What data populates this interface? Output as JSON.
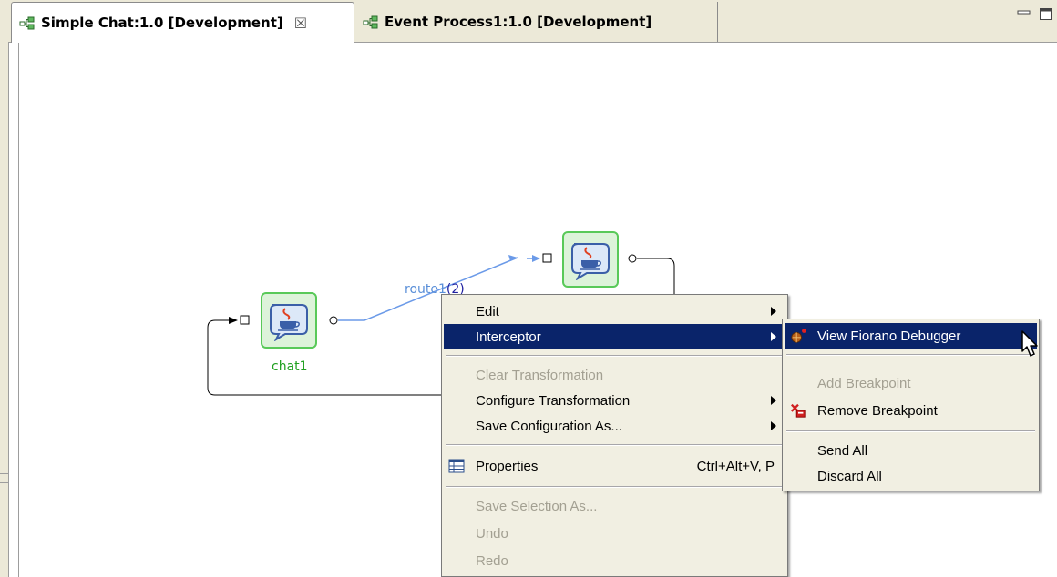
{
  "tabs": [
    {
      "label": "Simple Chat:1.0 [Development]",
      "icon": "flow-diagram-icon",
      "active": true,
      "closable": true
    },
    {
      "label": "Event Process1:1.0 [Development]",
      "icon": "flow-diagram-icon",
      "active": false
    }
  ],
  "window_controls": {
    "minimize": "minimize-icon",
    "maximize": "maximize-icon"
  },
  "canvas": {
    "nodes": [
      {
        "id": "chat1",
        "label": "chat1",
        "icon": "java-cup-icon"
      },
      {
        "id": "chat2",
        "label": "",
        "icon": "java-cup-icon"
      }
    ],
    "route": {
      "name": "route1",
      "count": "(2)"
    }
  },
  "context_menu": {
    "items": [
      {
        "label": "Edit",
        "submenu": true,
        "enabled": true
      },
      {
        "label": "Interceptor",
        "submenu": true,
        "enabled": true,
        "selected": true
      },
      {
        "label": "Clear Transformation",
        "enabled": false
      },
      {
        "label": "Configure Transformation",
        "submenu": true,
        "enabled": true
      },
      {
        "label": "Save Configuration As...",
        "submenu": true,
        "enabled": true
      },
      {
        "label": "Properties",
        "shortcut": "Ctrl+Alt+V, P",
        "icon": "properties-table-icon",
        "enabled": true
      },
      {
        "label": "Save Selection As...",
        "enabled": false
      },
      {
        "label": "Undo",
        "enabled": false
      },
      {
        "label": "Redo",
        "enabled": false
      }
    ]
  },
  "interceptor_submenu": {
    "items": [
      {
        "label": "View Fiorano Debugger",
        "icon": "bug-icon",
        "enabled": true,
        "selected": true
      },
      {
        "label": "Add Breakpoint",
        "enabled": false
      },
      {
        "label": "Remove Breakpoint",
        "icon": "remove-breakpoint-icon",
        "enabled": true
      },
      {
        "label": "Send All",
        "enabled": true
      },
      {
        "label": "Discard All",
        "enabled": true
      }
    ]
  },
  "colors": {
    "menu_selection": "#0a246a",
    "menu_background": "#f1efe2",
    "node_border": "#59c959",
    "node_label": "#20a020",
    "route_line": "#6b9ae8",
    "tab_bar": "#ece9d8"
  }
}
